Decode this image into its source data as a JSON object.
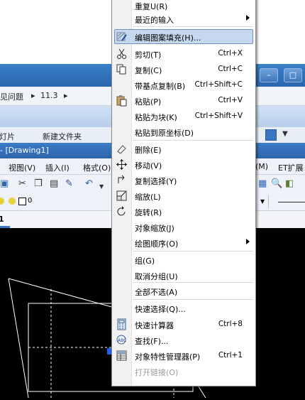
{
  "background": {
    "breadcrumb": [
      "见问题",
      "11.3"
    ],
    "tabs": [
      "幻灯片",
      "新建文件夹"
    ],
    "app_title": "- [Drawing1]",
    "menubar": [
      "视图(V)",
      "插入(I)",
      "格式(O)",
      "(M)",
      "ET扩展"
    ],
    "layer_value": "0",
    "doc_tab": "1"
  },
  "context_menu": {
    "items": [
      {
        "label": "重复U(R)",
        "shortcut": "",
        "icon": "",
        "submenu": false,
        "disabled": false
      },
      {
        "label": "最近的输入",
        "shortcut": "",
        "icon": "",
        "submenu": true,
        "disabled": false
      },
      {
        "label": "编辑图案填充(H)...",
        "shortcut": "",
        "icon": "hatch-edit-icon",
        "submenu": false,
        "disabled": false,
        "highlighted": true
      },
      {
        "label": "剪切(T)",
        "shortcut": "Ctrl+X",
        "icon": "scissors-icon",
        "submenu": false,
        "disabled": false
      },
      {
        "label": "复制(C)",
        "shortcut": "Ctrl+C",
        "icon": "copy-icon",
        "submenu": false,
        "disabled": false
      },
      {
        "label": "带基点复制(B)",
        "shortcut": "Ctrl+Shift+C",
        "icon": "",
        "submenu": false,
        "disabled": false
      },
      {
        "label": "粘贴(P)",
        "shortcut": "Ctrl+V",
        "icon": "paste-icon",
        "submenu": false,
        "disabled": false
      },
      {
        "label": "粘贴为块(K)",
        "shortcut": "Ctrl+Shift+V",
        "icon": "",
        "submenu": false,
        "disabled": false
      },
      {
        "label": "粘贴到原坐标(D)",
        "shortcut": "",
        "icon": "",
        "submenu": false,
        "disabled": false
      },
      {
        "label": "删除(E)",
        "shortcut": "",
        "icon": "eraser-icon",
        "submenu": false,
        "disabled": false
      },
      {
        "label": "移动(V)",
        "shortcut": "",
        "icon": "move-icon",
        "submenu": false,
        "disabled": false
      },
      {
        "label": "复制选择(Y)",
        "shortcut": "",
        "icon": "copy-selection-icon",
        "submenu": false,
        "disabled": false
      },
      {
        "label": "缩放(L)",
        "shortcut": "",
        "icon": "scale-icon",
        "submenu": false,
        "disabled": false
      },
      {
        "label": "旋转(R)",
        "shortcut": "",
        "icon": "rotate-icon",
        "submenu": false,
        "disabled": false
      },
      {
        "label": "对象缩放(J)",
        "shortcut": "",
        "icon": "",
        "submenu": false,
        "disabled": false
      },
      {
        "label": "绘图顺序(O)",
        "shortcut": "",
        "icon": "",
        "submenu": true,
        "disabled": false
      },
      {
        "label": "组(G)",
        "shortcut": "",
        "icon": "",
        "submenu": false,
        "disabled": false
      },
      {
        "label": "取消分组(U)",
        "shortcut": "",
        "icon": "",
        "submenu": false,
        "disabled": false
      },
      {
        "label": "全部不选(A)",
        "shortcut": "",
        "icon": "",
        "submenu": false,
        "disabled": false
      },
      {
        "label": "快速选择(Q)...",
        "shortcut": "",
        "icon": "",
        "submenu": false,
        "disabled": false
      },
      {
        "label": "快速计算器",
        "shortcut": "Ctrl+8",
        "icon": "calculator-icon",
        "submenu": false,
        "disabled": false
      },
      {
        "label": "查找(F)...",
        "shortcut": "",
        "icon": "find-abc-icon",
        "submenu": false,
        "disabled": false
      },
      {
        "label": "对象特性管理器(P)",
        "shortcut": "Ctrl+1",
        "icon": "properties-icon",
        "submenu": false,
        "disabled": false
      },
      {
        "label": "打开链接(O)",
        "shortcut": "",
        "icon": "",
        "submenu": false,
        "disabled": true
      }
    ]
  }
}
